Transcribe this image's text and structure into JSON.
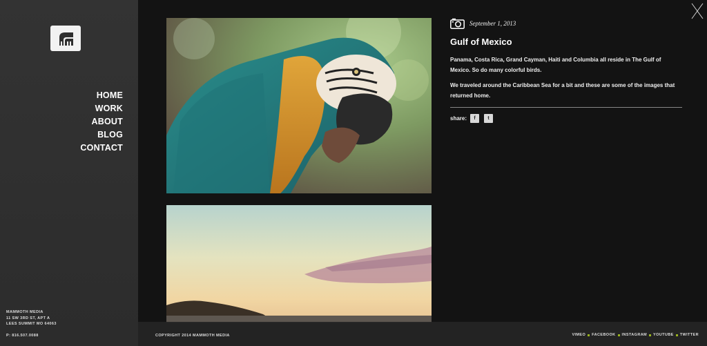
{
  "brand": {
    "logo_icon": "mammoth-logo-icon"
  },
  "nav": {
    "items": [
      {
        "label": "HOME"
      },
      {
        "label": "WORK"
      },
      {
        "label": "ABOUT"
      },
      {
        "label": "BLOG"
      },
      {
        "label": "CONTACT"
      }
    ]
  },
  "address": {
    "company": "MAMMOTH MEDIA",
    "street": "11 SW 3RD ST, APT A",
    "city": "LEES SUMMIT MO 64063",
    "phone": "P: 816.507.0088"
  },
  "post": {
    "icon": "camera-icon",
    "date": "September 1, 2013",
    "title": "Gulf of Mexico",
    "paragraph_1": "Panama, Costa Rica, Grand Cayman, Haiti and Columbia all reside in The Gulf of Mexico. So do many colorful birds.",
    "paragraph_2": "We traveled around the Caribbean Sea for a bit and these are some of the images that returned home.",
    "share_label": "share:",
    "share_facebook": "f",
    "share_twitter": "t"
  },
  "footer": {
    "copyright": "COPYRIGHT 2014 MAMMOTH MEDIA",
    "social": [
      {
        "label": "VIMEO"
      },
      {
        "label": "FACEBOOK"
      },
      {
        "label": "INSTAGRAM"
      },
      {
        "label": "YOUTUBE"
      },
      {
        "label": "TWITTER"
      }
    ]
  },
  "colors": {
    "background": "#131313",
    "sidebar": "#2f2f2f",
    "social_dot": "#9ab41e"
  }
}
